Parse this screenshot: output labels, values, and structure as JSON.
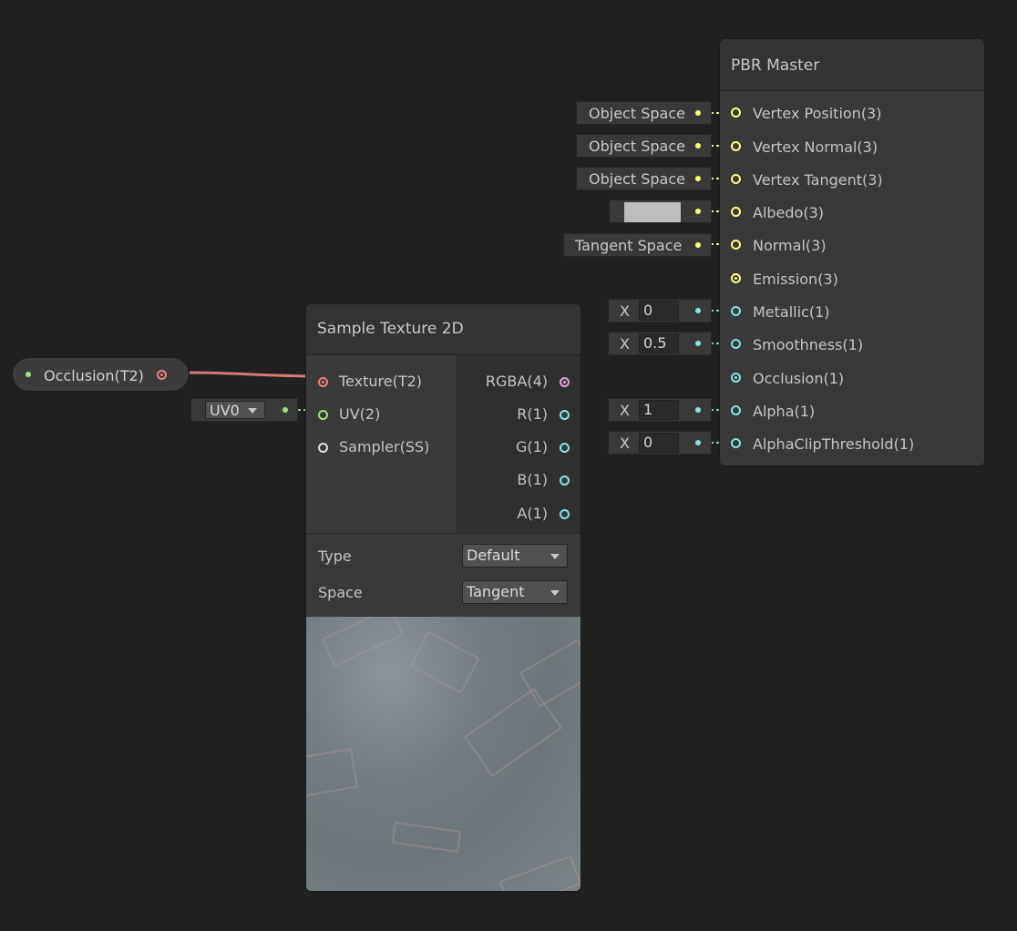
{
  "colors": {
    "background": "#202020",
    "vector3_port": "#ffff80",
    "vector1_port": "#84e4e7",
    "vector4_port": "#e4a0d8",
    "texture_port": "#f08080",
    "uv_port": "#9ce47a"
  },
  "pbr_master": {
    "title": "PBR Master",
    "inputs": [
      {
        "label": "Vertex Position(3)",
        "editor": "Object Space"
      },
      {
        "label": "Vertex Normal(3)",
        "editor": "Object Space"
      },
      {
        "label": "Vertex Tangent(3)",
        "editor": "Object Space"
      },
      {
        "label": "Albedo(3)",
        "editor_color": "#bdbdbd"
      },
      {
        "label": "Normal(3)",
        "editor": "Tangent Space"
      },
      {
        "label": "Emission(3)"
      },
      {
        "label": "Metallic(1)",
        "axis": "X",
        "value": "0"
      },
      {
        "label": "Smoothness(1)",
        "axis": "X",
        "value": "0.5"
      },
      {
        "label": "Occlusion(1)"
      },
      {
        "label": "Alpha(1)",
        "axis": "X",
        "value": "1"
      },
      {
        "label": "AlphaClipThreshold(1)",
        "axis": "X",
        "value": "0"
      }
    ]
  },
  "sample_texture": {
    "title": "Sample Texture 2D",
    "inputs": [
      {
        "label": "Texture(T2)"
      },
      {
        "label": "UV(2)"
      },
      {
        "label": "Sampler(SS)"
      }
    ],
    "outputs": [
      {
        "label": "RGBA(4)"
      },
      {
        "label": "R(1)"
      },
      {
        "label": "G(1)"
      },
      {
        "label": "B(1)"
      },
      {
        "label": "A(1)"
      }
    ],
    "type_label": "Type",
    "type_value": "Default",
    "space_label": "Space",
    "space_value": "Tangent",
    "uv_editor": "UV0"
  },
  "occlusion_property": {
    "label": "Occlusion(T2)"
  }
}
